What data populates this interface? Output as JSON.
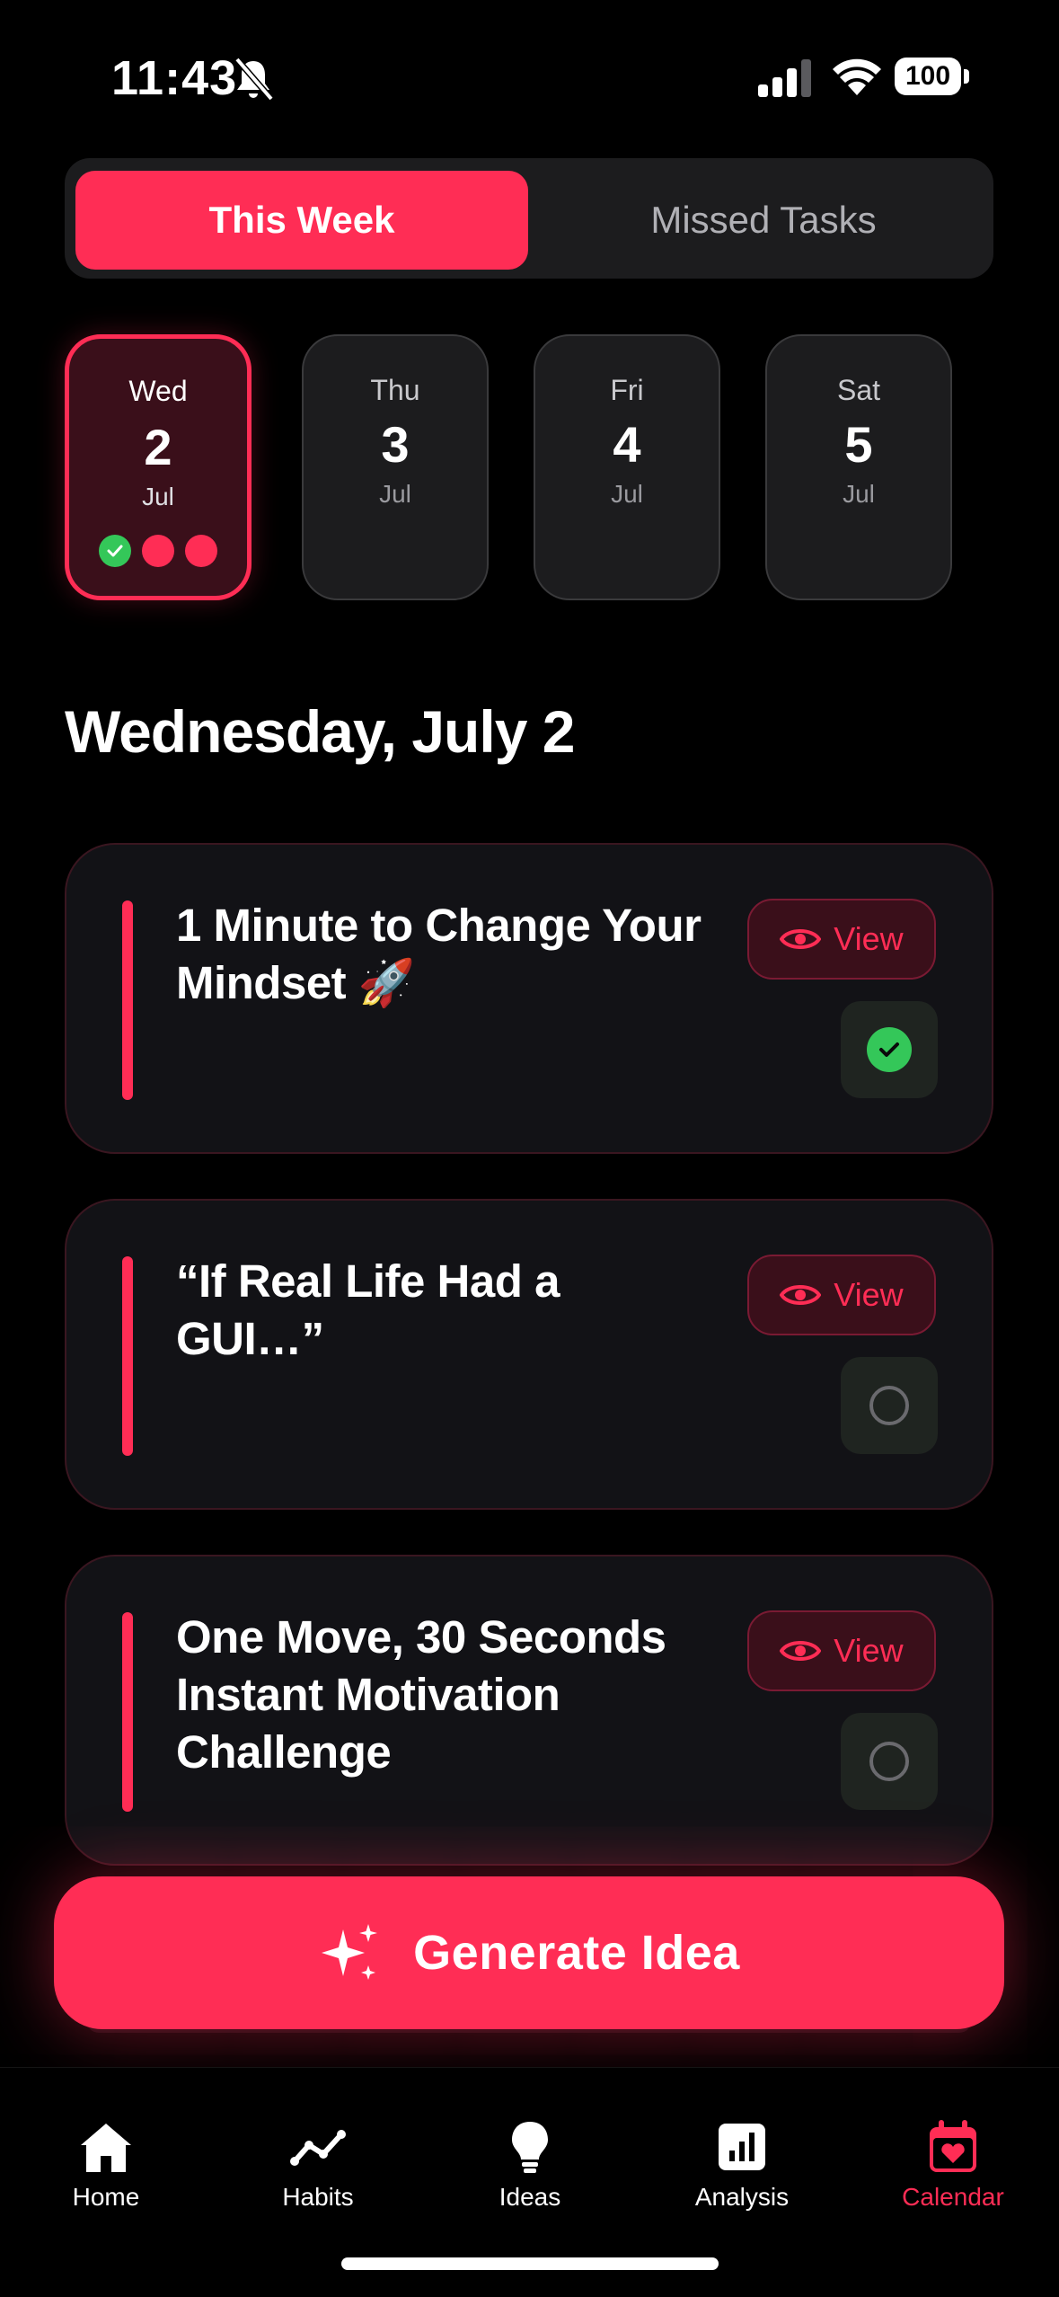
{
  "status_bar": {
    "time": "11:43",
    "battery": "100"
  },
  "segmented": {
    "active_label": "This Week",
    "inactive_label": "Missed Tasks"
  },
  "days": [
    {
      "name": "Wed",
      "num": "2",
      "month": "Jul",
      "selected": true,
      "dots": [
        "done",
        "pending",
        "pending"
      ]
    },
    {
      "name": "Thu",
      "num": "3",
      "month": "Jul"
    },
    {
      "name": "Fri",
      "num": "4",
      "month": "Jul"
    },
    {
      "name": "Sat",
      "num": "5",
      "month": "Jul"
    }
  ],
  "date_heading": "Wednesday, July 2",
  "tasks": [
    {
      "title": "1 Minute to Change Your Mindset 🚀",
      "view_label": "View",
      "completed": true
    },
    {
      "title": "“If Real Life Had a GUI…”",
      "view_label": "View",
      "completed": false
    },
    {
      "title": "One Move, 30 Seconds Instant Motivation Challenge",
      "view_label": "View",
      "completed": false
    }
  ],
  "generate_button": {
    "label": "Generate Idea",
    "icon": "sparkles-icon"
  },
  "tab_bar": {
    "items": [
      {
        "label": "Home",
        "icon": "home-icon"
      },
      {
        "label": "Habits",
        "icon": "trend-line-icon"
      },
      {
        "label": "Ideas",
        "icon": "lightbulb-icon"
      },
      {
        "label": "Analysis",
        "icon": "bar-chart-icon"
      },
      {
        "label": "Calendar",
        "icon": "calendar-heart-icon",
        "active": true
      }
    ]
  },
  "colors": {
    "accent": "#ff2d55",
    "success": "#34c759",
    "background": "#000000",
    "card": "#121216"
  }
}
